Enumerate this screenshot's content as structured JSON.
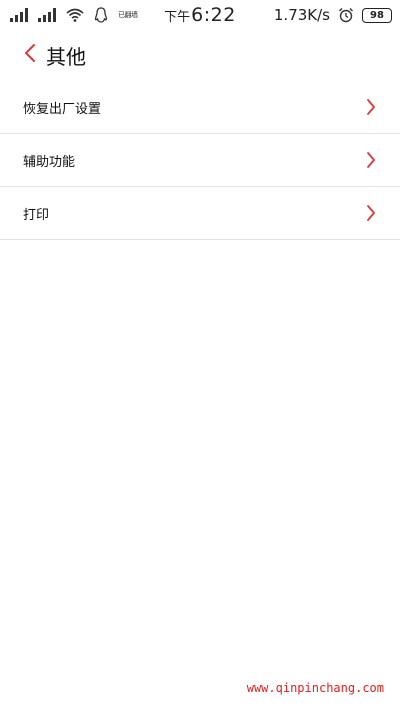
{
  "status_bar": {
    "notice_text": "已翻墙",
    "time_prefix": "下午",
    "time": "6:22",
    "network_speed": "1.73K/s",
    "battery_level": "98"
  },
  "header": {
    "title": "其他"
  },
  "settings": {
    "items": [
      {
        "label": "恢复出厂设置"
      },
      {
        "label": "辅助功能"
      },
      {
        "label": "打印"
      }
    ]
  },
  "watermark": {
    "text": "www.qinpinchang.com"
  },
  "colors": {
    "accent": "#d93a3a",
    "divider": "#e3e3e3",
    "background": "#ffffff",
    "watermark": "#e02020"
  }
}
